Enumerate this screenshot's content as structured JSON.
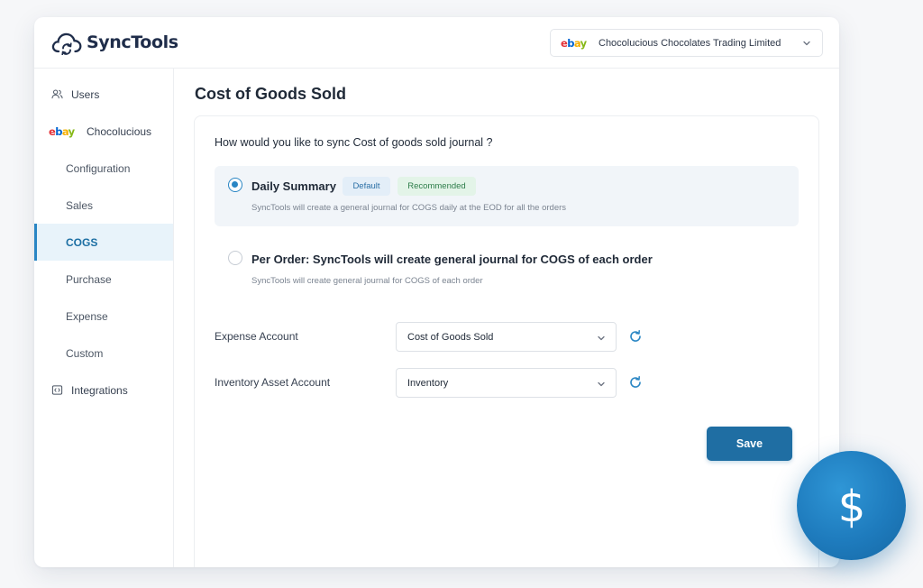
{
  "app": {
    "brand": "SyncTools",
    "account_selector": {
      "marketplace": "ebay",
      "value": "Chocolucious Chocolates Trading Limited"
    }
  },
  "sidebar": {
    "items": [
      {
        "label": "Users",
        "icon": "users-icon",
        "level": "top"
      },
      {
        "label": "Chocolucious",
        "icon": "ebay-logo",
        "level": "top"
      },
      {
        "label": "Configuration",
        "level": "sub"
      },
      {
        "label": "Sales",
        "level": "sub"
      },
      {
        "label": "COGS",
        "level": "sub",
        "active": true
      },
      {
        "label": "Purchase",
        "level": "sub"
      },
      {
        "label": "Expense",
        "level": "sub"
      },
      {
        "label": "Custom",
        "level": "sub"
      },
      {
        "label": "Integrations",
        "icon": "code-icon",
        "level": "top"
      }
    ]
  },
  "main": {
    "title": "Cost of Goods Sold",
    "question": "How would you like to sync Cost of goods sold journal ?",
    "options": [
      {
        "title": "Daily Summary",
        "badges": [
          "Default",
          "Recommended"
        ],
        "description": "SyncTools will create a general journal for COGS daily at the EOD for all the orders",
        "selected": true
      },
      {
        "title": "Per Order: SyncTools will create general journal for COGS of each order",
        "description": "SyncTools will create general journal for COGS of each order",
        "selected": false
      }
    ],
    "fields": [
      {
        "label": "Expense Account",
        "value": "Cost of Goods Sold"
      },
      {
        "label": "Inventory Asset Account",
        "value": "Inventory"
      }
    ],
    "save_label": "Save"
  },
  "decor": {
    "coin_symbol": "$"
  },
  "colors": {
    "accent": "#2a86c4",
    "primary_button": "#1f6ea3",
    "active_nav_bg": "#e8f3fa"
  }
}
